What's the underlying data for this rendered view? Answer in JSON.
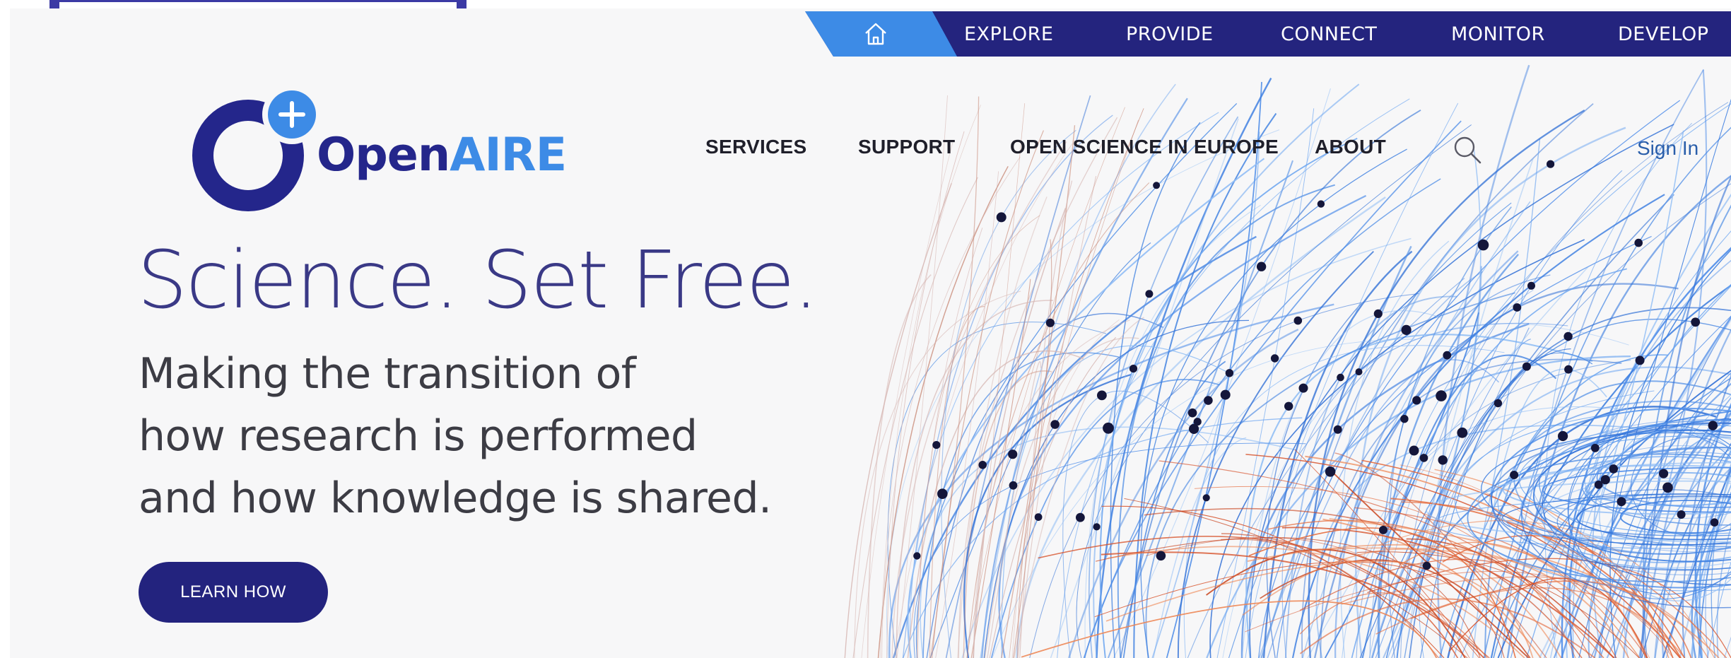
{
  "top_nav": {
    "items": [
      "EXPLORE",
      "PROVIDE",
      "CONNECT",
      "MONITOR",
      "DEVELOP"
    ]
  },
  "logo": {
    "part1": "Open",
    "part2": "AIRE"
  },
  "main_nav": {
    "items": [
      "SERVICES",
      "SUPPORT",
      "OPEN SCIENCE IN EUROPE",
      "ABOUT"
    ],
    "sign_in": "Sign In"
  },
  "hero": {
    "headline": "Science. Set Free.",
    "subtitle_lines": [
      "Making the transition of",
      "how research is performed",
      "and how knowledge is shared."
    ],
    "cta": "LEARN HOW"
  },
  "colors": {
    "navy": "#23237e",
    "brand_blue": "#3d8be6",
    "headline": "#3a3986"
  },
  "icons": [
    "home-icon",
    "search-icon",
    "plus-icon"
  ]
}
